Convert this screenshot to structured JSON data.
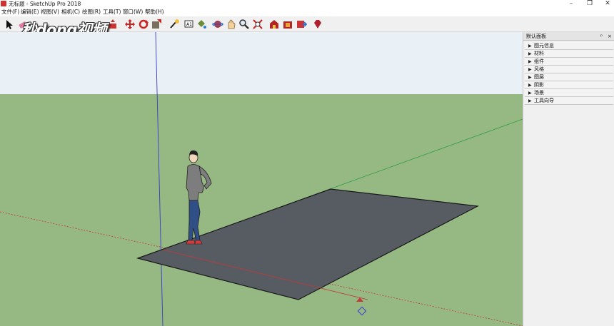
{
  "window": {
    "title": "无标题 - SketchUp Pro 2018"
  },
  "menu": [
    "文件(F)",
    "编辑(E)",
    "视图(V)",
    "相机(C)",
    "绘图(R)",
    "工具(T)",
    "窗口(W)",
    "帮助(H)"
  ],
  "watermark": "秒dong视频",
  "toolbar": {
    "icons": [
      "select-icon",
      "eraser-icon",
      "line-icon",
      "rectangle-icon",
      "push-pull-icon",
      "move-icon",
      "rotate-icon",
      "scale-icon",
      "tape-measure-icon",
      "text-icon",
      "paint-bucket-icon",
      "orbit-icon",
      "pan-icon",
      "zoom-icon",
      "zoom-extents-icon",
      "warehouse-icon",
      "extension-warehouse-icon",
      "send-to-layout-icon",
      "ruby-icon"
    ]
  },
  "tray": {
    "title": "默认面板",
    "pin": "ᵖ",
    "close": "×",
    "panels": [
      "图元信息",
      "材料",
      "组件",
      "风格",
      "图层",
      "阴影",
      "场景",
      "工具向导"
    ]
  },
  "scene": {
    "sky_color": "#eaf1f6",
    "ground_color": "#96b883",
    "plane_color": "#575b62",
    "axis_colors": {
      "red": "#c23a3a",
      "green": "#3aa04a",
      "blue": "#3a3acf"
    }
  }
}
